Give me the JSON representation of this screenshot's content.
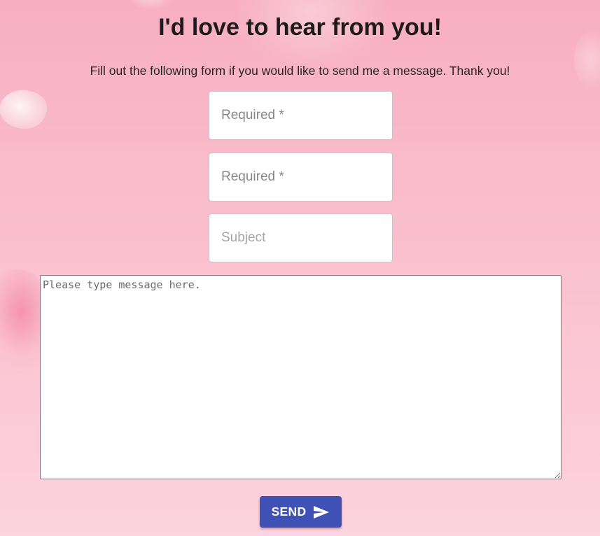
{
  "header": {
    "title": "I'd love to hear from you!",
    "subtitle": "Fill out the following form if you would like to send me a message. Thank you!"
  },
  "form": {
    "name_placeholder": "Required *",
    "email_placeholder": "Required *",
    "subject_placeholder": "Subject",
    "message_placeholder": "Please type message here.",
    "send_label": "SEND",
    "send_icon": "send-icon"
  },
  "colors": {
    "background": "#f9bccb",
    "button": "#3f51b5",
    "button_text": "#ffffff",
    "title_text": "#1f1a1c"
  }
}
